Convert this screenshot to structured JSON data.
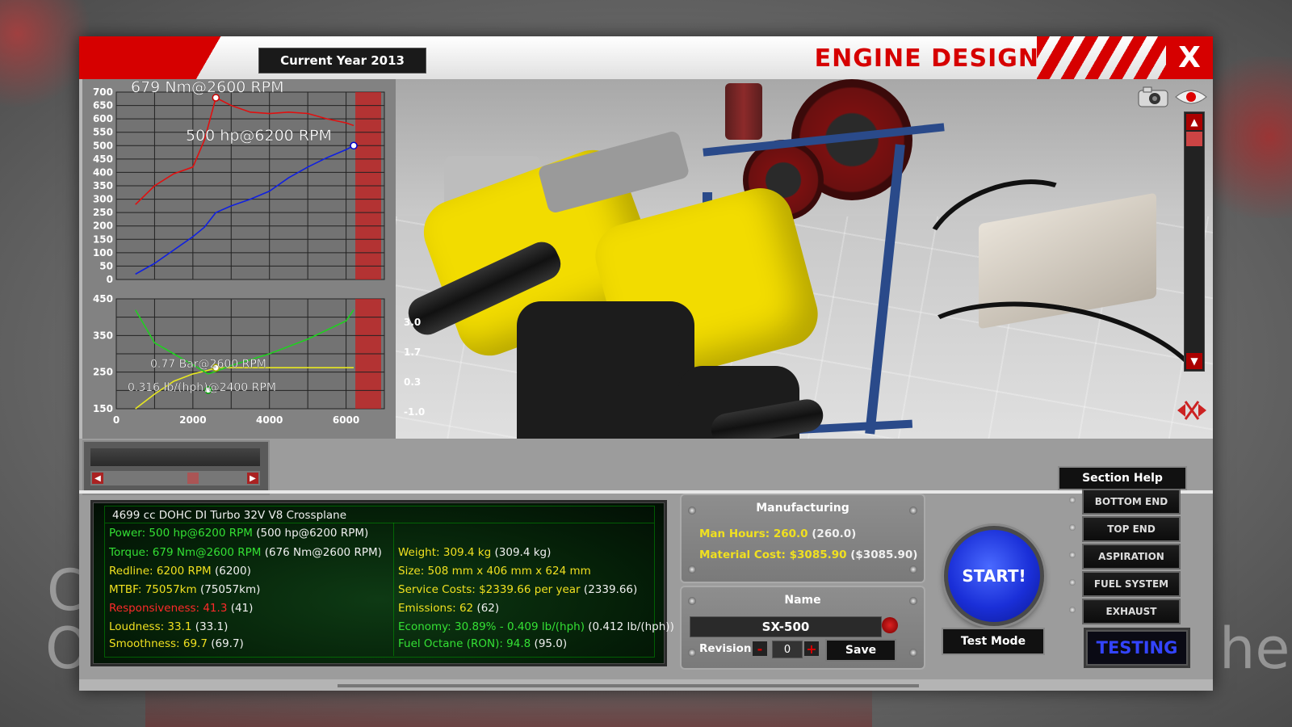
{
  "window": {
    "year_label": "Current Year 2013",
    "title": "ENGINE DESIGN",
    "close_label": "X"
  },
  "background": {
    "letters_left": [
      "C",
      "O"
    ],
    "letters_right": "he"
  },
  "graph": {
    "top": {
      "y_ticks": [
        "700",
        "650",
        "600",
        "550",
        "500",
        "450",
        "400",
        "350",
        "300",
        "250",
        "200",
        "150",
        "100",
        "50",
        "0"
      ],
      "torque_label": "679 Nm@2600 RPM",
      "power_label": "500 hp@6200 RPM",
      "torque_color": "#e01010",
      "power_color": "#1020e0"
    },
    "bottom": {
      "y_ticks": [
        "450",
        "350",
        "250",
        "150"
      ],
      "x_ticks": [
        "0",
        "2000",
        "4000",
        "6000"
      ],
      "right_ticks": [
        "3.0",
        "1.7",
        "0.3",
        "-1.0"
      ],
      "boost_label": "0.77 Bar@2600 RPM",
      "bsfc_label": "0.316 lb/(hph)@2400 RPM",
      "boost_color": "#e8e820",
      "bsfc_color": "#20d020"
    }
  },
  "chart_data": [
    {
      "type": "line",
      "x": [
        500,
        1000,
        1500,
        2000,
        2300,
        2600,
        3000,
        3500,
        4000,
        4500,
        5000,
        5500,
        6000,
        6200
      ],
      "series": [
        {
          "name": "Torque",
          "values": [
            280,
            350,
            395,
            420,
            520,
            679,
            650,
            625,
            620,
            625,
            620,
            600,
            585,
            575
          ]
        },
        {
          "name": "Power",
          "values": [
            20,
            60,
            110,
            160,
            195,
            250,
            275,
            300,
            330,
            380,
            420,
            455,
            485,
            500
          ]
        }
      ],
      "ylim": [
        0,
        700
      ],
      "xlim": [
        0,
        7000
      ]
    },
    {
      "type": "line",
      "x": [
        500,
        1000,
        1500,
        2000,
        2400,
        2600,
        3000,
        4000,
        5000,
        6000,
        6200
      ],
      "series": [
        {
          "name": "Boost",
          "values": [
            150,
            190,
            225,
            245,
            255,
            262,
            262,
            262,
            262,
            262,
            262
          ]
        },
        {
          "name": "BSFC",
          "values": [
            420,
            330,
            300,
            270,
            245,
            252,
            268,
            300,
            340,
            390,
            420
          ]
        }
      ],
      "ylim": [
        150,
        450
      ],
      "xlim": [
        0,
        7000
      ]
    }
  ],
  "lower": {
    "section_help": "Section Help"
  },
  "stats": {
    "engine": "4699 cc DOHC DI Turbo 32V V8 Crossplane",
    "power": {
      "label": "Power: 500 hp@6200 RPM",
      "extra": "(500 hp@6200 RPM)"
    },
    "torque": {
      "label": "Torque: 679 Nm@2600 RPM",
      "extra": "(676 Nm@2600 RPM)"
    },
    "redline": {
      "label": "Redline: 6200 RPM",
      "extra": "(6200)"
    },
    "mtbf": {
      "label": "MTBF: 75057km",
      "extra": "(75057km)"
    },
    "responsiveness": {
      "label": "Responsiveness: 41.3",
      "extra": "(41)"
    },
    "loudness": {
      "label": "Loudness: 33.1",
      "extra": "(33.1)"
    },
    "smoothness": {
      "label": "Smoothness: 69.7",
      "extra": "(69.7)"
    },
    "weight": {
      "label": "Weight: 309.4 kg",
      "extra": "(309.4 kg)"
    },
    "size": {
      "label": "Size: 508 mm x 406 mm x 624 mm",
      "extra": ""
    },
    "service": {
      "label": "Service Costs: $2339.66 per year",
      "extra": "(2339.66)"
    },
    "emissions": {
      "label": "Emissions: 62",
      "extra": "(62)"
    },
    "economy": {
      "label": "Economy: 30.89% - 0.409 lb/(hph)",
      "extra": "(0.412 lb/(hph))"
    },
    "octane": {
      "label": "Fuel Octane (RON): 94.8",
      "extra": "(95.0)"
    }
  },
  "manufacturing": {
    "title": "Manufacturing",
    "man_hours": "Man Hours: 260.0",
    "man_hours_extra": "(260.0)",
    "material_cost": "Material Cost: $3085.90",
    "material_cost_extra": "($3085.90)"
  },
  "name_panel": {
    "title": "Name",
    "name_value": "SX-500",
    "revision_label": "Revision",
    "revision_value": "0",
    "minus": "-",
    "plus": "+",
    "save_label": "Save"
  },
  "actions": {
    "start_label": "START!",
    "test_mode_label": "Test Mode"
  },
  "nav": {
    "items": [
      "BOTTOM END",
      "TOP END",
      "ASPIRATION",
      "FUEL SYSTEM",
      "EXHAUST"
    ],
    "active": "TESTING"
  }
}
